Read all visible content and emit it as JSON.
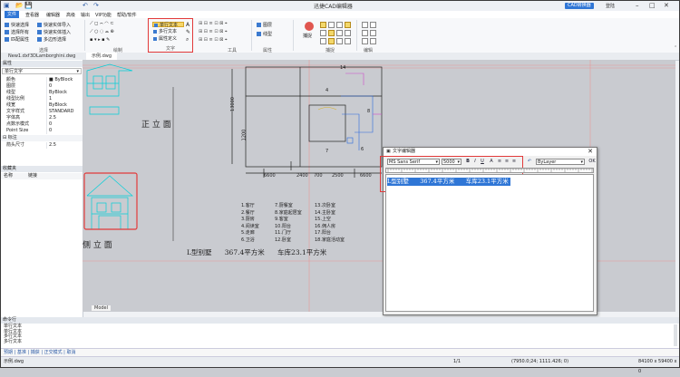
{
  "app": {
    "title": "迅捷CAD编辑器",
    "promo": "CAD转换器",
    "login": "登陆"
  },
  "menus": [
    "文件",
    "查看器",
    "编辑器",
    "高级",
    "输出",
    "VIP功能",
    "帮助/软件"
  ],
  "ribbon": {
    "select": {
      "items": [
        "快速选择",
        "选择所有",
        "匹配属性",
        "快速实体导入",
        "快速实体插入",
        "多边形选择"
      ],
      "label": "选择"
    },
    "draw": {
      "label": "绘制"
    },
    "text": {
      "items": [
        "单行文本",
        "多行文本",
        "属性定义"
      ],
      "label": "文字"
    },
    "tools": {
      "label": "工具"
    },
    "props": {
      "items": [
        "图层",
        "线型"
      ],
      "label": "属性"
    },
    "capture": {
      "btn": "捕捉",
      "label": "捕捉"
    },
    "edit": {
      "label": "编辑"
    }
  },
  "colors": {
    "accent": "#2f76d6",
    "highlight": "#f6d66a",
    "redbox": "#e23a3a",
    "cad_cyan": "#00cfd8"
  },
  "tabs": [
    "New1.dxf",
    "3DLamborghini.dwg",
    "示例.dwg"
  ],
  "props_panel": {
    "title": "属性",
    "selector": "单行文字",
    "rows": [
      {
        "k": "颜色",
        "v": "■ ByBlock"
      },
      {
        "k": "图层",
        "v": "0"
      },
      {
        "k": "线型",
        "v": "ByBlock"
      },
      {
        "k": "线型比例",
        "v": "1"
      },
      {
        "k": "线宽",
        "v": "ByBlock"
      },
      {
        "k": "文字样式",
        "v": "STANDARD"
      },
      {
        "k": "字体高",
        "v": "2.5"
      },
      {
        "k": "点数示模式",
        "v": "0"
      },
      {
        "k": "Point Size",
        "v": "0"
      }
    ],
    "cat2": "标注",
    "rows2": [
      {
        "k": "箭头尺寸",
        "v": "2.5"
      }
    ]
  },
  "bookmark": {
    "title": "收藏夹",
    "col1": "名称",
    "col2": "链接"
  },
  "drawing": {
    "front": "正 立 面",
    "side": "侧 立 面",
    "info": "L型别墅      367.4平方米      车库23.1平方米",
    "dims": [
      "13000",
      "6600",
      "2400",
      "700",
      "2500",
      "6600",
      "1200"
    ],
    "nums": [
      "14",
      "4",
      "8",
      "6",
      "7"
    ],
    "legend": [
      [
        "1.客厅",
        "7.厨餐室",
        "13.次卧室"
      ],
      [
        "2.餐厅",
        "8.家庭起居室",
        "14.主卧室"
      ],
      [
        "3.厨房",
        "9.客室",
        "15.上空"
      ],
      [
        "4.阅读室",
        "10.阳台",
        "16.佣人房"
      ],
      [
        "5.走廊",
        "11.门厅",
        "17.阳台"
      ],
      [
        "6.卫浴",
        "12.卧室",
        "18.家庭活动室"
      ]
    ]
  },
  "model_tab": "Model",
  "dialog": {
    "title": "文字编辑器",
    "font": "MS Sans Serif",
    "size": "5000",
    "layer": "ByLayer",
    "ok": "OK",
    "format_btns": [
      "B",
      "I",
      "U",
      "A",
      "≡",
      "≡",
      "≡",
      "↶"
    ],
    "text": "L型别墅      367.4平方米      车库23.1平方米"
  },
  "command": {
    "title": "命令行",
    "lines": [
      "单行文本",
      "单行文本",
      "多行文本",
      "多行文本"
    ],
    "input": "预期 | 基准 | 捕获 | 正交模式 | 取消",
    "status_file": "示例.dwg",
    "page": "1/1",
    "coords": "(7950.0;24; 1111.426; 0)",
    "size": "84100 x 59400 x 0"
  }
}
